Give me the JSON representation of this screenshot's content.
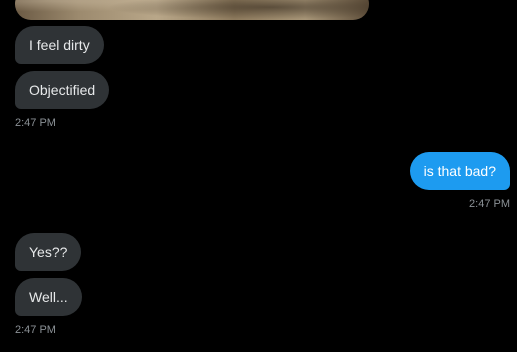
{
  "conversation": {
    "group1": {
      "messages": [
        "I feel dirty",
        "Objectified"
      ],
      "timestamp": "2:47 PM"
    },
    "group2": {
      "messages": [
        "is that bad?"
      ],
      "timestamp": "2:47 PM"
    },
    "group3": {
      "messages": [
        "Yes??",
        "Well..."
      ],
      "timestamp": "2:47 PM"
    }
  },
  "colors": {
    "background": "#000000",
    "received_bubble": "#2f3336",
    "sent_bubble": "#1d9bf0",
    "timestamp_text": "#8b9196"
  }
}
